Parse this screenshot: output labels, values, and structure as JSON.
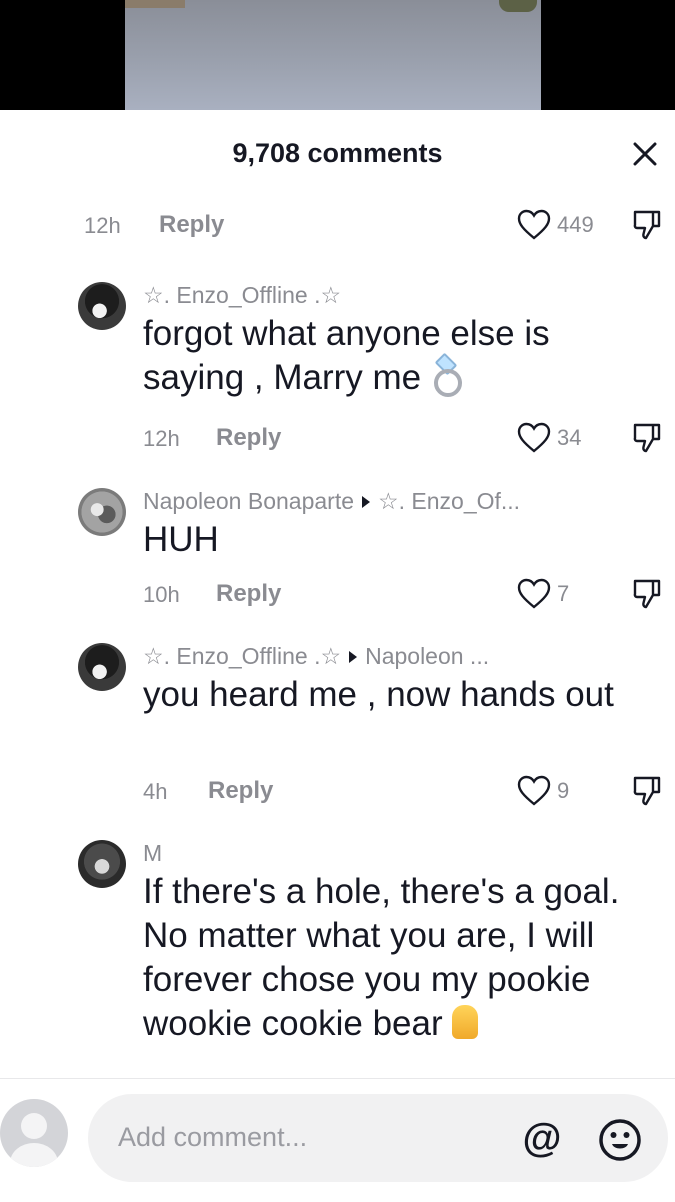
{
  "header": {
    "title": "9,708 comments"
  },
  "top_row": {
    "time": "12h",
    "reply_label": "Reply",
    "likes": "449"
  },
  "comments": [
    {
      "username": "☆. Enzo_Offline .☆",
      "reply_to": "",
      "text": "forgot what anyone else is saying , Marry me",
      "emoji": "ring",
      "time": "12h",
      "reply_label": "Reply",
      "likes": "34"
    },
    {
      "username": "Napoleon Bonaparte",
      "reply_to": "☆. Enzo_Of...",
      "text": "HUH",
      "time": "10h",
      "reply_label": "Reply",
      "likes": "7"
    },
    {
      "username": "☆. Enzo_Offline .☆",
      "reply_to": "Napoleon ...",
      "text": "you heard me , now hands out",
      "time": "4h",
      "reply_label": "Reply",
      "likes": "9"
    },
    {
      "username": "M",
      "reply_to": "",
      "text": "If there's a hole, there's a goal. No matter what you are, I will forever chose you my pookie wookie cookie bear",
      "emoji": "folded-hands"
    }
  ],
  "input": {
    "placeholder": "Add comment...",
    "mention_label": "@"
  },
  "icons": {
    "close": "close-icon",
    "like": "heart-outline-icon",
    "dislike": "thumbs-down-icon",
    "emoji": "smiley-icon",
    "profile": "profile-placeholder-icon"
  },
  "colors": {
    "text": "#161823",
    "muted": "#8a8b91",
    "input_bg": "#f1f1f2"
  }
}
